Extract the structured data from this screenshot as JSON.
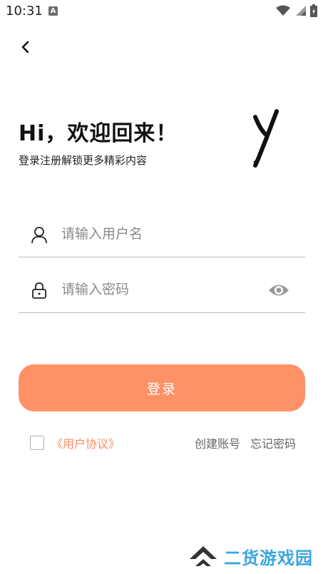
{
  "status_bar": {
    "time": "10:31",
    "badge": "A",
    "icons": [
      "wifi-icon",
      "cell-signal-icon",
      "battery-charging-icon"
    ]
  },
  "nav": {
    "back_icon": "chevron-left-icon"
  },
  "header": {
    "greeting": "Hi，欢迎回来！",
    "subtitle": "登录注册解锁更多精彩内容",
    "brand_mark": "brush-y-logo"
  },
  "form": {
    "username": {
      "placeholder": "请输入用户名",
      "value": "",
      "icon": "user-icon"
    },
    "password": {
      "placeholder": "请输入密码",
      "value": "",
      "icon": "lock-icon",
      "toggle_icon": "eye-icon"
    },
    "login_label": "登录"
  },
  "footer": {
    "agreement_checked": false,
    "agreement_label": "《用户协议》",
    "create_account": "创建账号",
    "forgot_password": "忘记密码"
  },
  "watermark": {
    "text": "二货游戏园"
  },
  "colors": {
    "accent": "#ff9166",
    "agreement_link": "#ff8a5c",
    "watermark_blue": "#3aa6e0",
    "watermark_dark": "#333333"
  }
}
